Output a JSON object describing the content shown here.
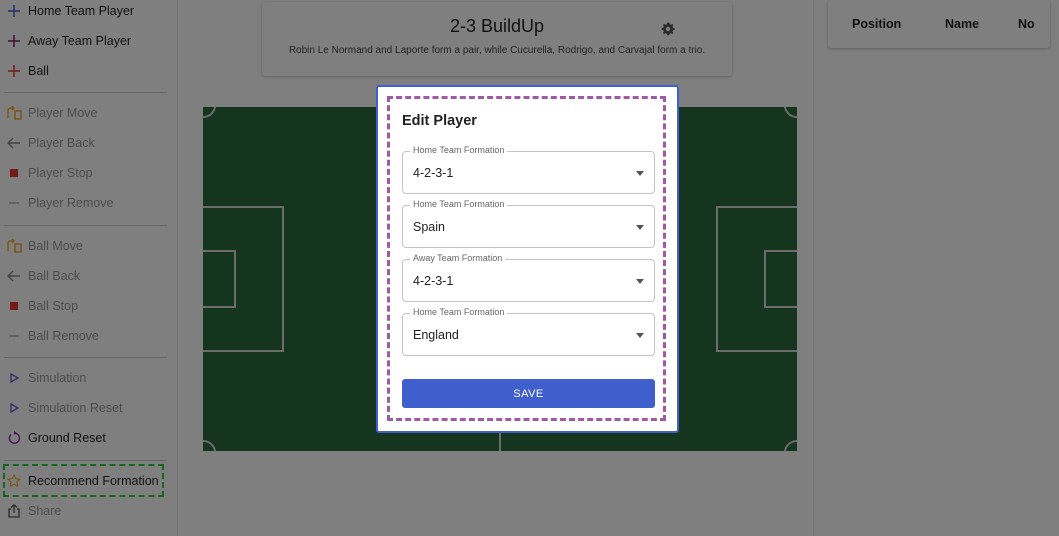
{
  "sidebar": {
    "items": [
      {
        "label": "Home Team Player",
        "icon": "plus-icon",
        "color": "#3f5fcc",
        "disabled": false
      },
      {
        "label": "Away Team Player",
        "icon": "plus-icon",
        "color": "#7b1f5c",
        "disabled": false
      },
      {
        "label": "Ball",
        "icon": "plus-icon",
        "color": "#e53935",
        "disabled": false
      },
      {
        "label": "Player Move",
        "icon": "move-icon",
        "color": "#f5a623",
        "disabled": true
      },
      {
        "label": "Player Back",
        "icon": "arrow-left-icon",
        "color": "#666666",
        "disabled": true
      },
      {
        "label": "Player Stop",
        "icon": "stop-icon",
        "color": "#e53935",
        "disabled": true
      },
      {
        "label": "Player Remove",
        "icon": "minus-icon",
        "color": "#999999",
        "disabled": true
      },
      {
        "label": "Ball Move",
        "icon": "move-icon",
        "color": "#f5a623",
        "disabled": true
      },
      {
        "label": "Ball Back",
        "icon": "arrow-left-icon",
        "color": "#666666",
        "disabled": true
      },
      {
        "label": "Ball Stop",
        "icon": "stop-icon",
        "color": "#e53935",
        "disabled": true
      },
      {
        "label": "Ball Remove",
        "icon": "minus-icon",
        "color": "#999999",
        "disabled": true
      },
      {
        "label": "Simulation",
        "icon": "play-icon",
        "color": "#6a5acd",
        "disabled": true
      },
      {
        "label": "Simulation Reset",
        "icon": "play-icon",
        "color": "#6a5acd",
        "disabled": true
      },
      {
        "label": "Ground Reset",
        "icon": "reset-icon",
        "color": "#9b27b0",
        "disabled": false
      },
      {
        "label": "Recommend Formation",
        "icon": "star-icon",
        "color": "#f5a623",
        "disabled": false
      },
      {
        "label": "Share",
        "icon": "share-icon",
        "color": "#555555",
        "disabled": true
      }
    ]
  },
  "header": {
    "title": "2-3 BuildUp",
    "description": "Robin Le Normand and Laporte form a pair, while Cucurella, Rodrigo, and Carvajal form a trio."
  },
  "table": {
    "columns": [
      "Position",
      "Name",
      "No"
    ]
  },
  "modal": {
    "title": "Edit Player",
    "fields": [
      {
        "label": "Home Team Formation",
        "value": "4-2-3-1"
      },
      {
        "label": "Home Team Formation",
        "value": "Spain"
      },
      {
        "label": "Away Team Formation",
        "value": "4-2-3-1"
      },
      {
        "label": "Home Team Formation",
        "value": "England"
      }
    ],
    "save_label": "SAVE"
  },
  "colors": {
    "pitch": "#2a6b3c",
    "accent": "#3f5fcc",
    "highlight_green": "#2ecc40",
    "highlight_purple": "#a05aa5"
  }
}
